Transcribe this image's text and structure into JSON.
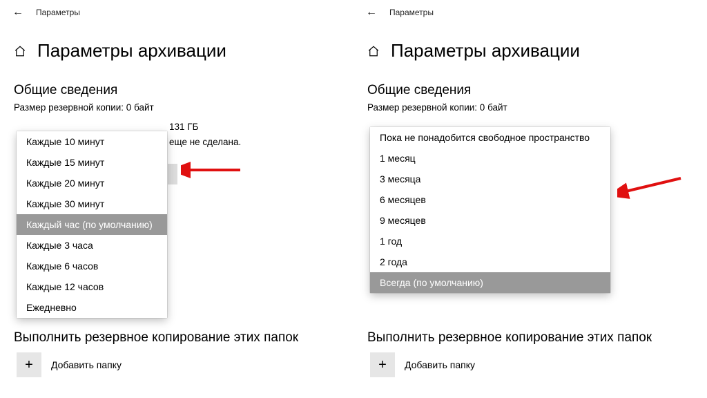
{
  "window_label": "Параметры",
  "page_title": "Параметры архивации",
  "section_overview": "Общие сведения",
  "backup_size_line": "Размер резервной копии: 0 байт",
  "left": {
    "drive_fragment": "131 ГБ",
    "not_yet_fragment": "еще не сделана.",
    "stray1": "",
    "stray2": "",
    "freq_options": [
      "Каждые 10 минут",
      "Каждые 15 минут",
      "Каждые 20 минут",
      "Каждые 30 минут",
      "Каждый час (по умолчанию)",
      "Каждые 3 часа",
      "Каждые 6 часов",
      "Каждые 12 часов",
      "Ежедневно"
    ],
    "freq_selected_index": 4
  },
  "right": {
    "keep_options": [
      "Пока не понадобится свободное пространство",
      "1 месяц",
      "3 месяца",
      "6 месяцев",
      "9 месяцев",
      "1 год",
      "2 года",
      "Всегда (по умолчанию)"
    ],
    "keep_selected_index": 7
  },
  "folders_header": "Выполнить резервное копирование этих папок",
  "add_folder_label": "Добавить папку",
  "arrow_color": "#e01010"
}
